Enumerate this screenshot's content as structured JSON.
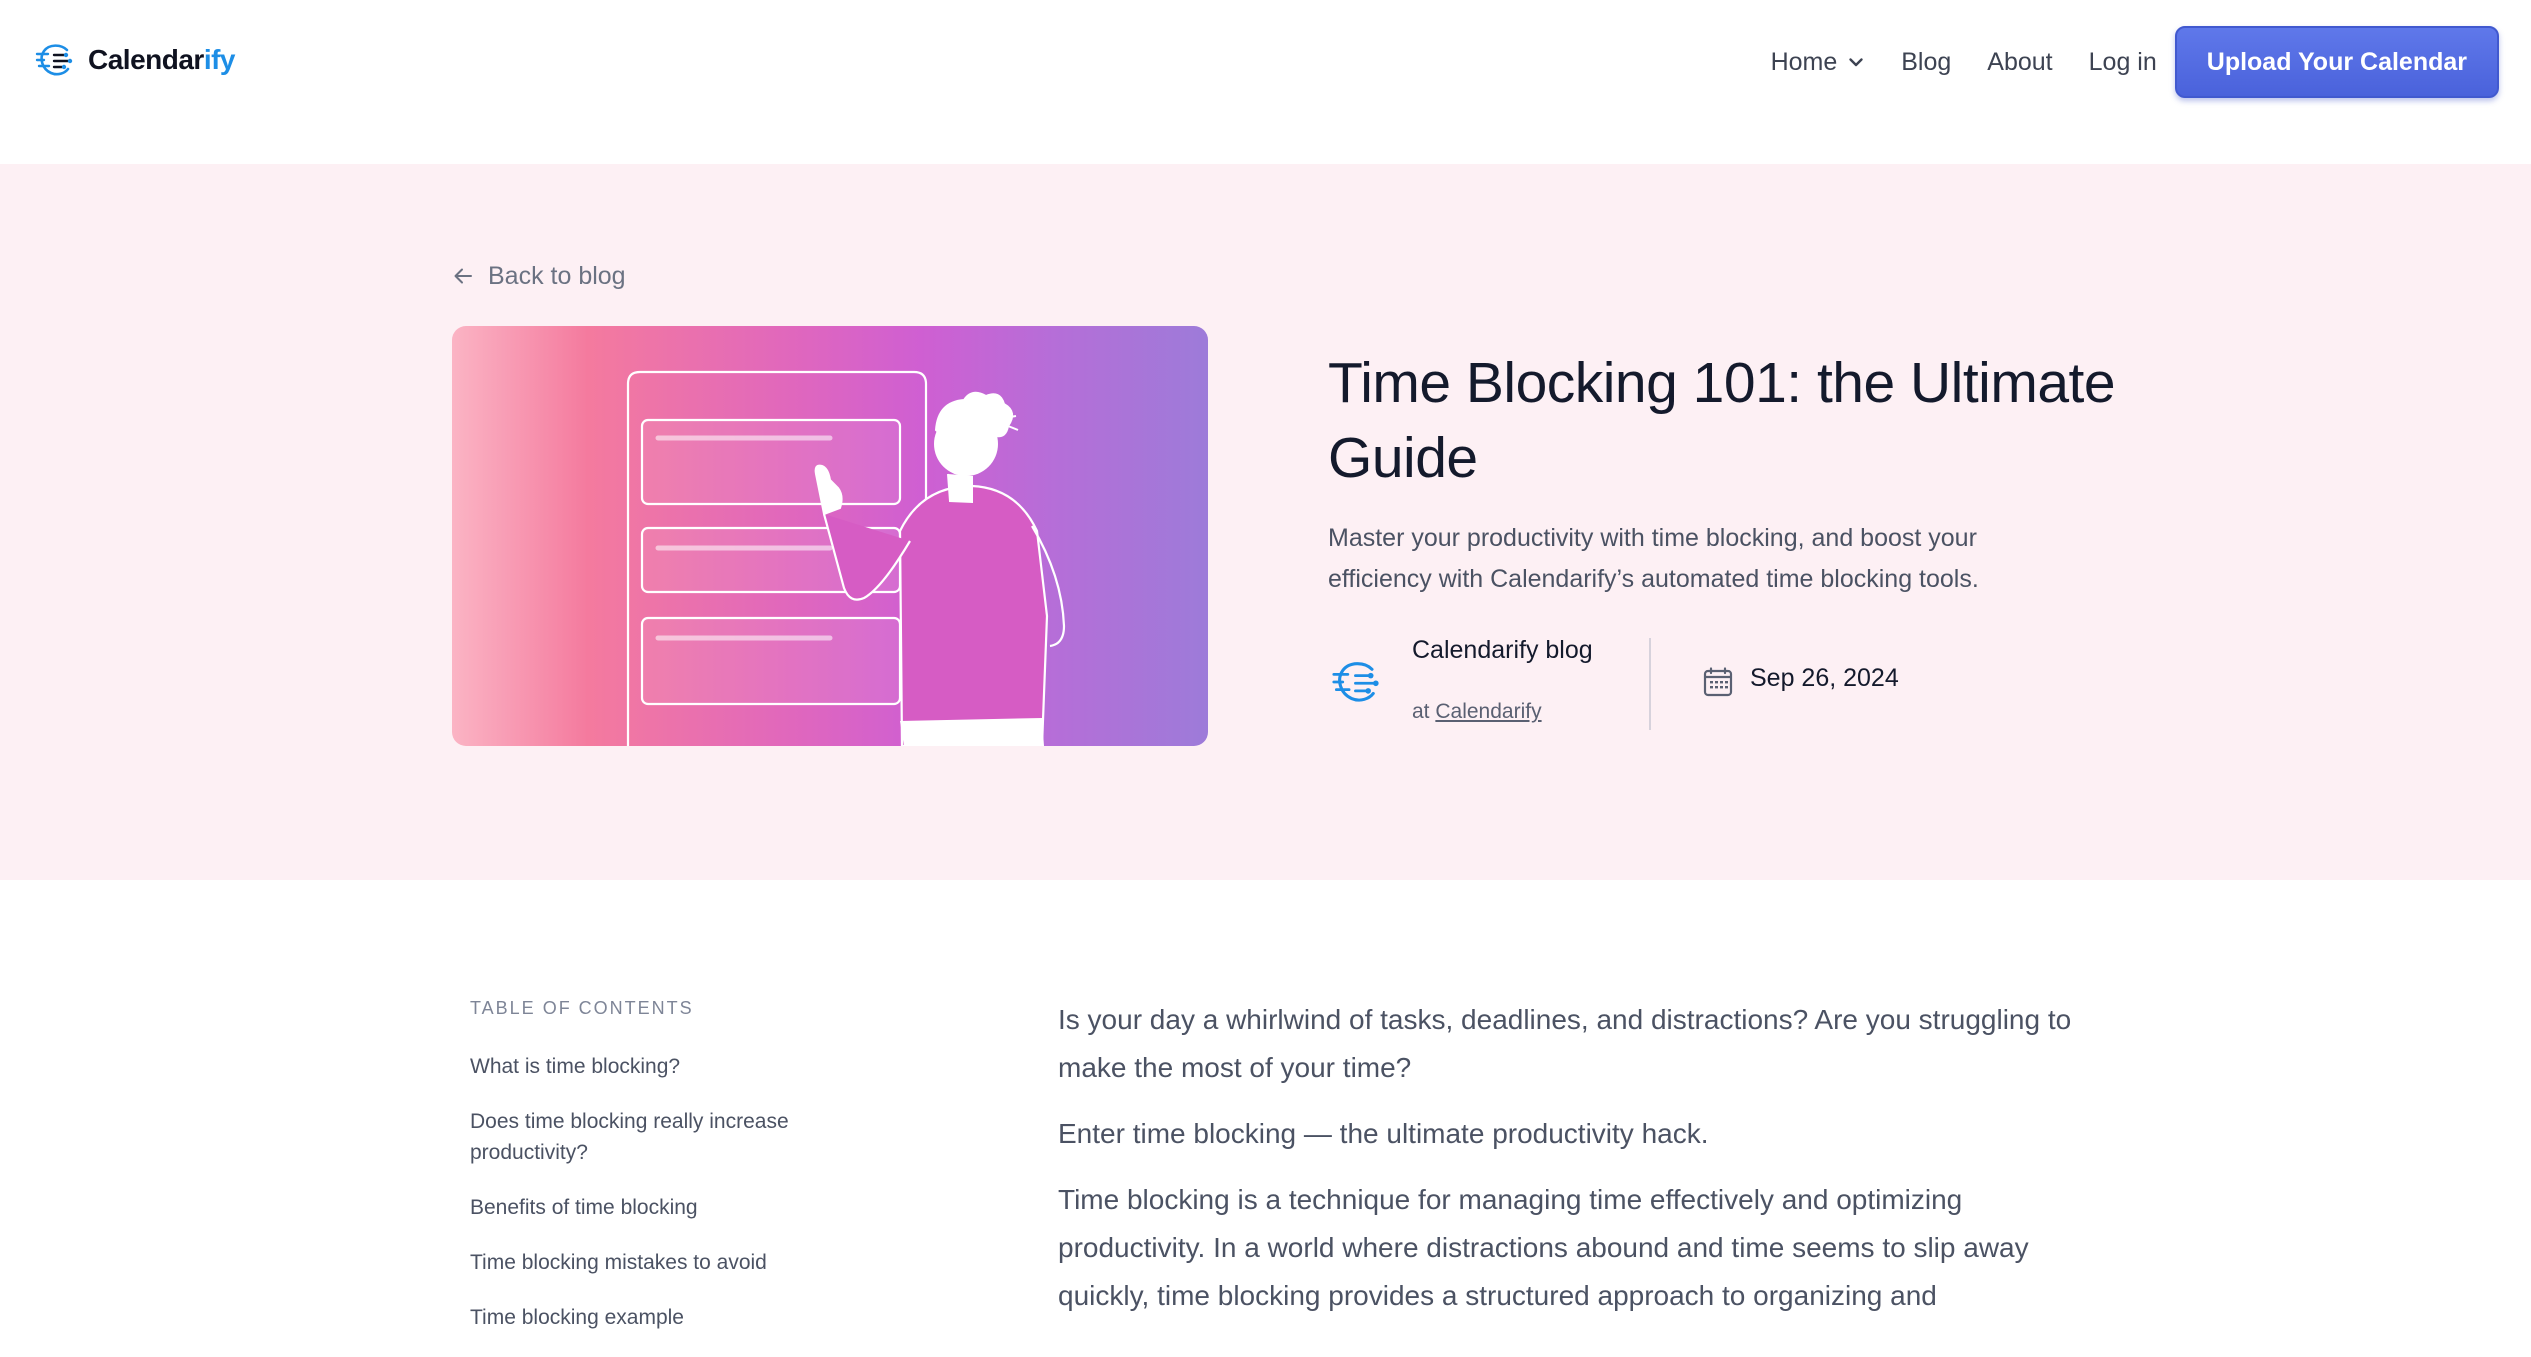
{
  "header": {
    "logo_main": "Calendar",
    "logo_accent": "ify",
    "nav": {
      "home": "Home",
      "blog": "Blog",
      "about": "About",
      "login": "Log in"
    },
    "cta": "Upload Your Calendar"
  },
  "hero": {
    "back_link": "Back to blog",
    "title": "Time Blocking 101: the Ultimate Guide",
    "subtitle": "Master your productivity with time blocking, and boost your efficiency with Calendarify’s automated time blocking tools.",
    "author": {
      "name": "Calendarify blog",
      "at_prefix": "at",
      "org": "Calendarify"
    },
    "date": "Sep 26, 2024"
  },
  "toc": {
    "heading": "TABLE OF CONTENTS",
    "items": [
      "What is time blocking?",
      "Does time blocking really increase productivity?",
      "Benefits of time blocking",
      "Time blocking mistakes to avoid",
      "Time blocking example"
    ]
  },
  "article": {
    "paragraphs": [
      "Is your day a whirlwind of tasks, deadlines, and distractions? Are you struggling to make the most of your time?",
      "Enter time blocking — the ultimate productivity hack.",
      "Time blocking is a technique for managing time effectively and optimizing productivity. In a world where distractions abound and time seems to slip away quickly, time blocking provides a structured approach to organizing and"
    ]
  },
  "colors": {
    "brand_blue": "#1d8ee6",
    "cta": "#4f67df",
    "hero_bg": "#fdf0f4"
  },
  "icons": [
    "calendarify-logo-icon",
    "chevron-down-icon",
    "arrow-left-icon",
    "calendar-icon"
  ]
}
